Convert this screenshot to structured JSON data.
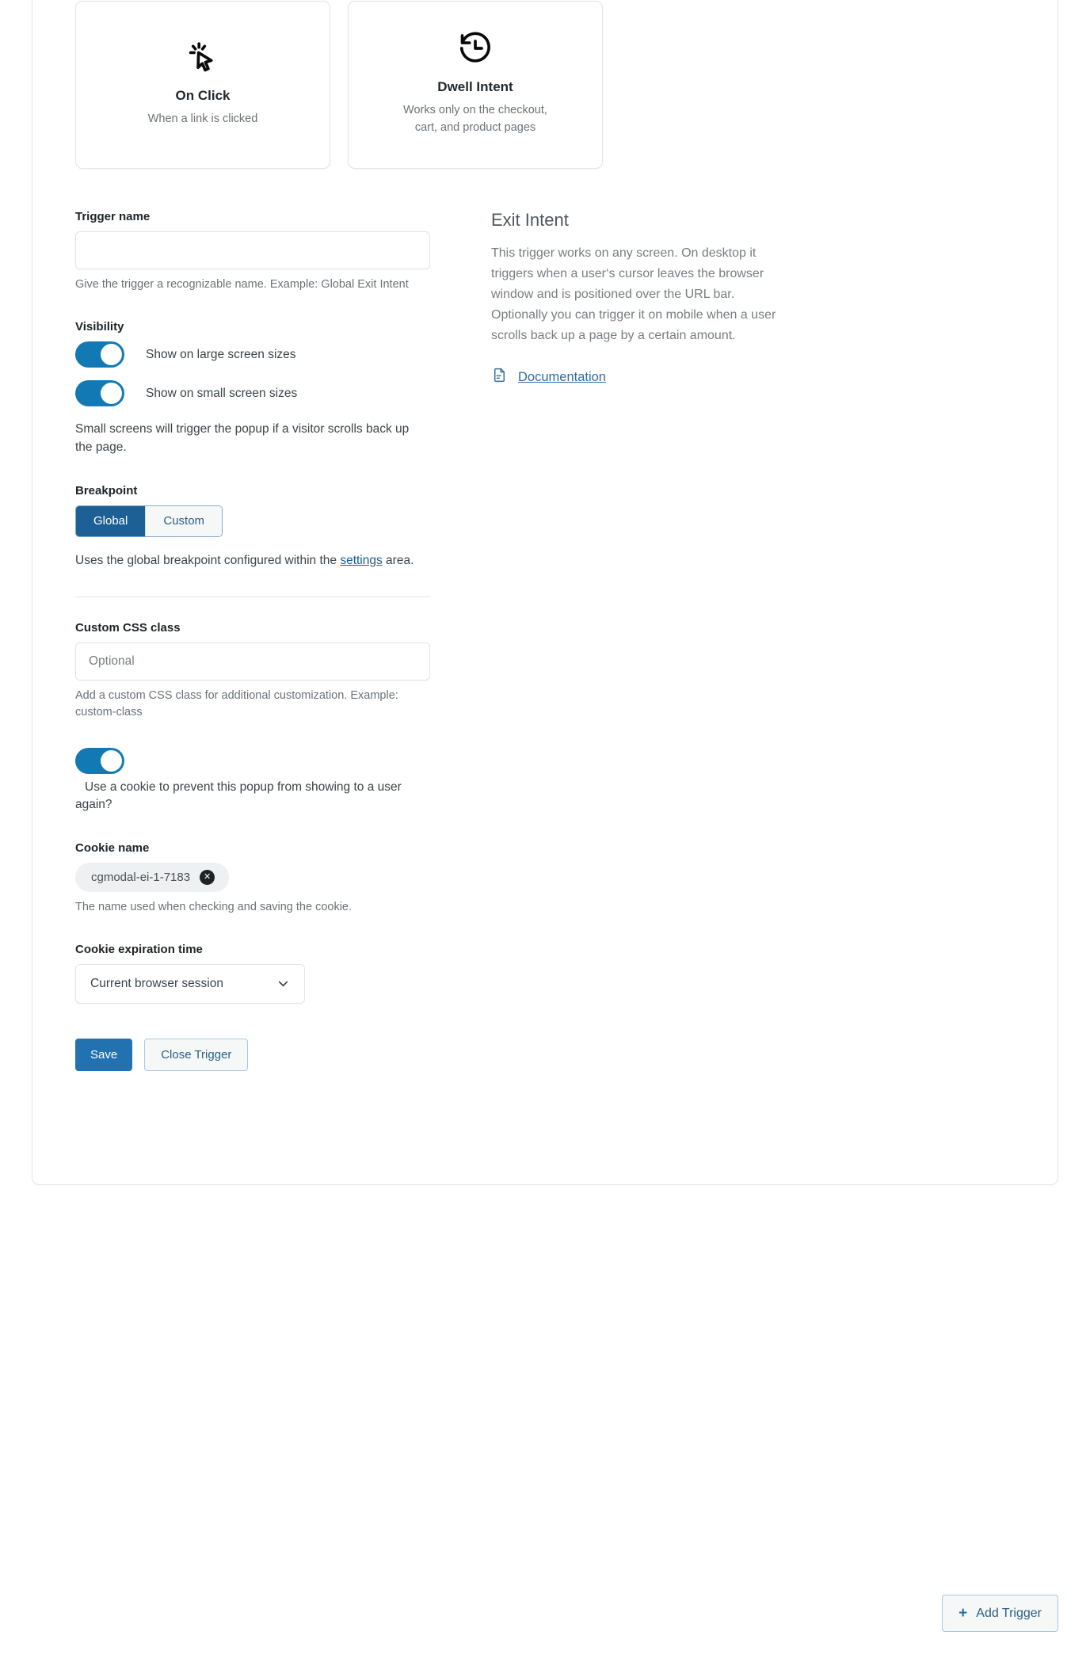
{
  "colors": {
    "accent": "#2271b1",
    "toggle_on": "#1379b5",
    "selected_card_bg": "#eef5f7",
    "selected_card_border": "#7fadd0",
    "link": "#135e96"
  },
  "trigger_types": [
    {
      "name": "",
      "description": "",
      "icon": "partial-card",
      "selected": false,
      "partial": true
    },
    {
      "name": "",
      "description": "",
      "icon": "partial-card",
      "selected": true,
      "partial": true
    },
    {
      "name": "",
      "description": "",
      "icon": "partial-card",
      "selected": false,
      "partial": true
    },
    {
      "name": "On Click",
      "description": "When a link is clicked",
      "icon": "click-cursor-icon",
      "selected": false,
      "partial": false
    },
    {
      "name": "Dwell Intent",
      "description": "Works only on the checkout, cart, and product pages",
      "icon": "clock-rewind-icon",
      "selected": false,
      "partial": false
    }
  ],
  "form": {
    "trigger_name": {
      "label": "Trigger name",
      "value": "",
      "placeholder": "",
      "help": "Give the trigger a recognizable name. Example: Global Exit Intent"
    },
    "visibility": {
      "label": "Visibility",
      "toggles": [
        {
          "label": "Show on large screen sizes",
          "on": true
        },
        {
          "label": "Show on small screen sizes",
          "on": true
        }
      ],
      "help": "Small screens will trigger the popup if a visitor scrolls back up the page."
    },
    "breakpoint": {
      "label": "Breakpoint",
      "options": [
        "Global",
        "Custom"
      ],
      "selected": "Global",
      "help_before": "Uses the global breakpoint configured within the ",
      "help_link": "settings",
      "help_after": " area."
    },
    "custom_css": {
      "label": "Custom CSS class",
      "value": "",
      "placeholder": "Optional",
      "help": "Add a custom CSS class for additional customization. Example: custom-class"
    },
    "cookie_toggle": {
      "on": true,
      "label": "Use a cookie to prevent this popup from showing to a user again?"
    },
    "cookie_name": {
      "label": "Cookie name",
      "chip_value": "cgmodal-ei-1-7183",
      "help": "The name used when checking and saving the cookie."
    },
    "cookie_expiration": {
      "label": "Cookie expiration time",
      "selected": "Current browser session",
      "options": [
        "Current browser session"
      ]
    },
    "actions": {
      "save": "Save",
      "close": "Close Trigger"
    }
  },
  "info_panel": {
    "title": "Exit Intent",
    "body": "This trigger works on any screen. On desktop it triggers when a user‘s cursor leaves the browser window and is positioned over the URL bar. Optionally you can trigger it on mobile when a user scrolls back up a page by a certain amount.",
    "doc_link": "Documentation"
  },
  "footer": {
    "add_trigger": "Add Trigger"
  }
}
